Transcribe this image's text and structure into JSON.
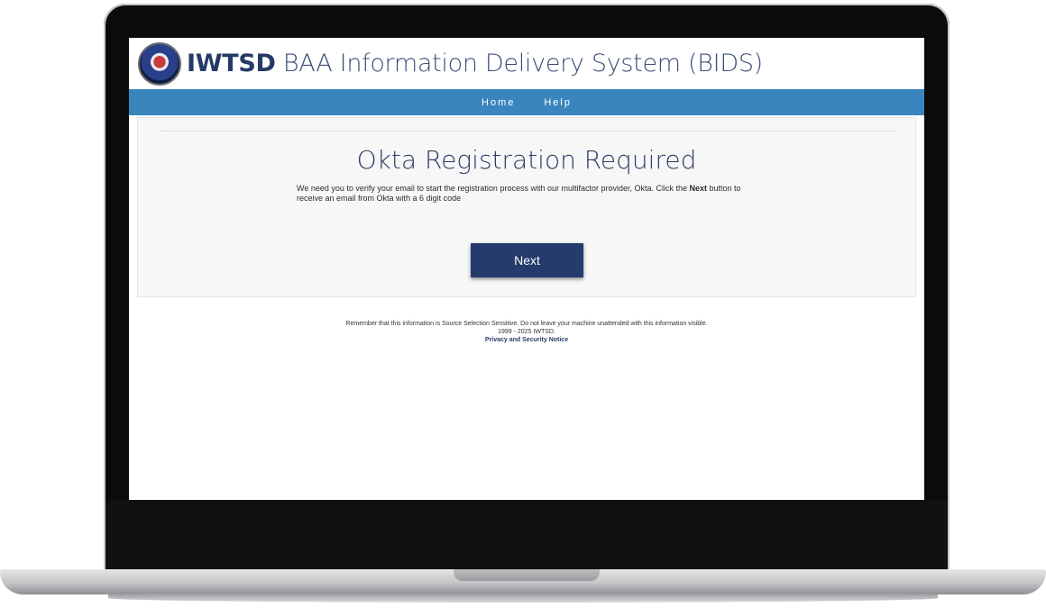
{
  "header": {
    "logo_icon": "iwtsd-seal-icon",
    "title_bold": "IWTSD",
    "title_rest": "BAA Information Delivery System (BIDS)"
  },
  "nav": {
    "items": [
      {
        "label": "Home"
      },
      {
        "label": "Help"
      }
    ]
  },
  "panel": {
    "heading": "Okta Registration Required",
    "text_before": "We need you to verify your email to start the registration process with our multifactor provider, Okta. Click the ",
    "text_bold": "Next",
    "text_after": " button to receive an email from Okta with a 6 digit code",
    "button_label": "Next"
  },
  "footer": {
    "notice": "Remember that this information is Source Selection Sensitive. Do not leave your machine unattended with this information visible.",
    "copyright": "1999 - 2025 IWTSD.",
    "privacy_link": "Privacy and Security Notice"
  },
  "colors": {
    "nav_bar": "#3a85bd",
    "brand_navy": "#243b6b",
    "panel_bg": "#f7f7f7"
  }
}
